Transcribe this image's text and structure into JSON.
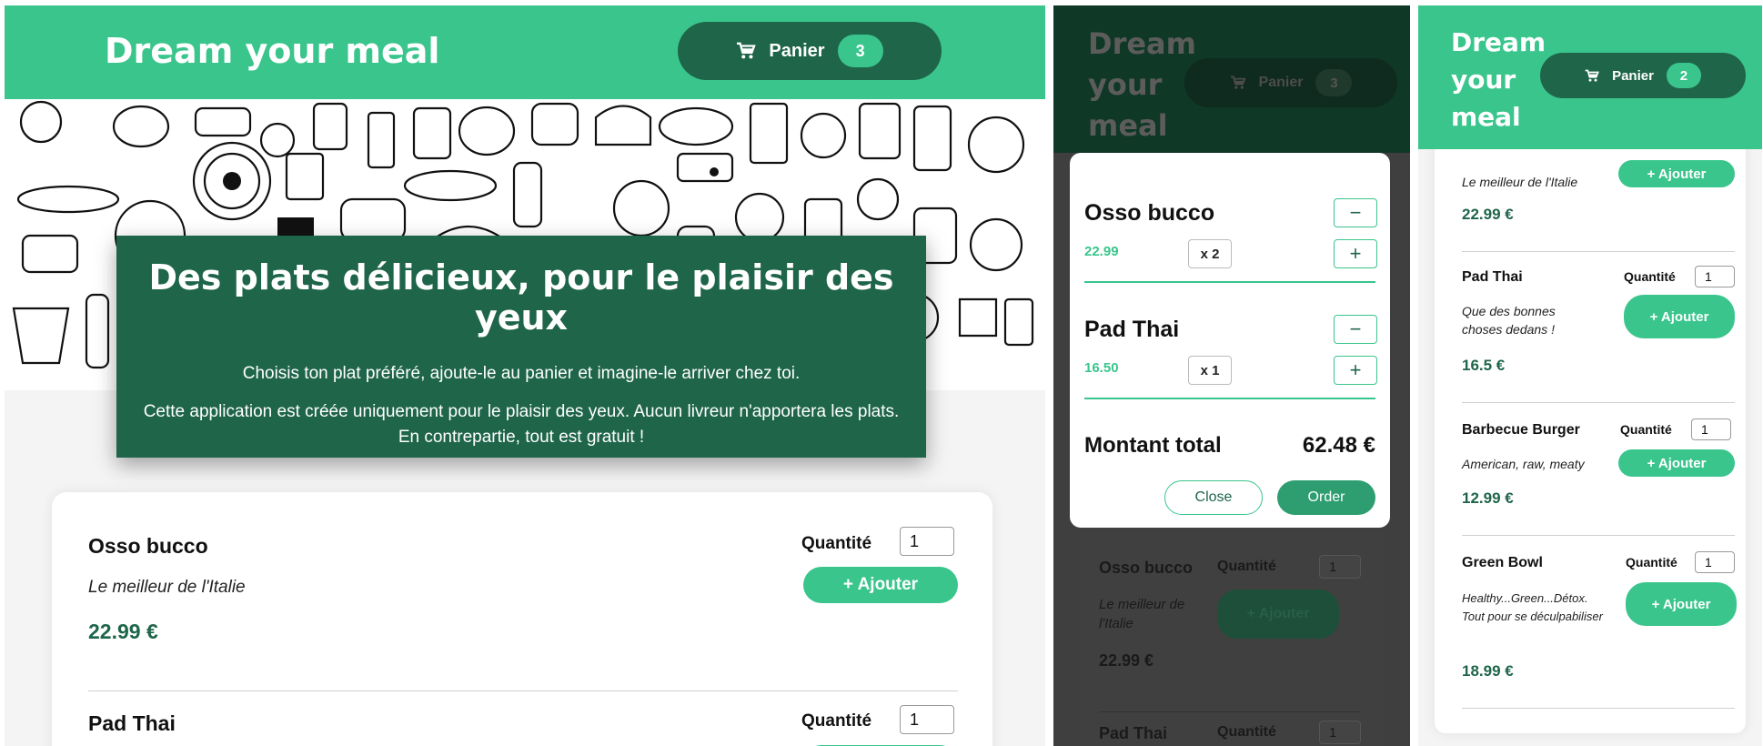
{
  "app": {
    "title": "Dream your meal",
    "accent": "#3ac58c",
    "dark": "#1e654a"
  },
  "cart": {
    "label": "Panier",
    "icon": "cart-icon"
  },
  "desktop": {
    "cart_count": "3",
    "hero": {
      "title": "Des plats délicieux, pour le plaisir des yeux",
      "line1": "Choisis ton plat préféré, ajoute-le au panier et imagine-le arriver chez toi.",
      "line2": "Cette application est créée uniquement pour le plaisir des yeux. Aucun livreur n'apportera les plats. En contrepartie, tout est gratuit !"
    },
    "meals": [
      {
        "name": "Osso bucco",
        "desc": "Le meilleur de l'Italie",
        "price": "22.99 €",
        "qty_label": "Quantité",
        "qty": "1",
        "add": "+ Ajouter"
      },
      {
        "name": "Pad Thai",
        "qty_label": "Quantité",
        "qty": "1"
      }
    ]
  },
  "cart_modal": {
    "brand_lines": [
      "Dream",
      "your",
      "meal"
    ],
    "cart_count": "3",
    "items": [
      {
        "name": "Osso bucco",
        "price": "22.99",
        "qty": "x 2",
        "minus": "−",
        "plus": "+"
      },
      {
        "name": "Pad Thai",
        "price": "16.50",
        "qty": "x 1",
        "minus": "−",
        "plus": "+"
      }
    ],
    "total_label": "Montant total",
    "total_value": "62.48 €",
    "close": "Close",
    "order": "Order",
    "background_meals": [
      {
        "name": "Osso bucco",
        "qty_label": "Quantité",
        "qty": "1",
        "desc": "Le meilleur de l'Italie",
        "add": "+ Ajouter",
        "price": "22.99 €"
      },
      {
        "name": "Pad Thai",
        "qty_label": "Quantité",
        "qty": "1"
      }
    ]
  },
  "mobile": {
    "brand_lines": [
      "Dream",
      "your",
      "meal"
    ],
    "cart_count": "2",
    "meals": [
      {
        "desc": "Le meilleur de l'Italie",
        "add": "+ Ajouter",
        "price": "22.99 €"
      },
      {
        "name": "Pad Thai",
        "qty_label": "Quantité",
        "qty": "1",
        "desc": "Que des bonnes choses dedans !",
        "add": "+ Ajouter",
        "price": "16.5 €"
      },
      {
        "name": "Barbecue Burger",
        "qty_label": "Quantité",
        "qty": "1",
        "desc": "American, raw, meaty",
        "add": "+ Ajouter",
        "price": "12.99 €"
      },
      {
        "name": "Green Bowl",
        "qty_label": "Quantité",
        "qty": "1",
        "desc": "Healthy...Green...Détox. Tout pour se déculpabiliser",
        "add": "+ Ajouter",
        "price": "18.99 €"
      }
    ]
  }
}
